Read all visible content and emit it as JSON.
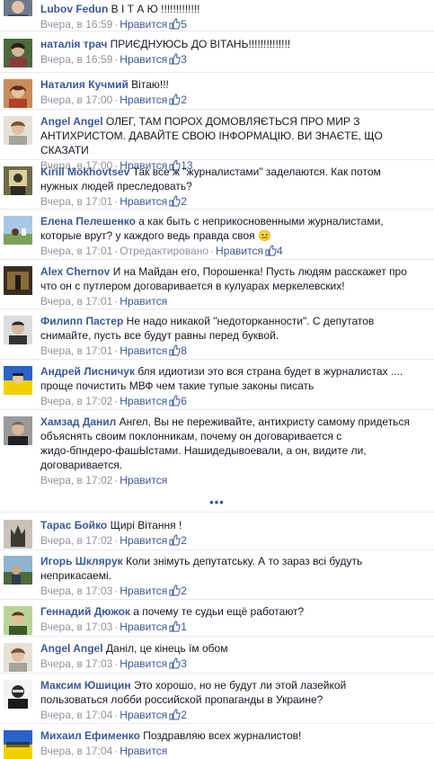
{
  "ui": {
    "like_label": "Нравится",
    "separator": "·",
    "more_label": "•••"
  },
  "comments": [
    {
      "author": "Lubov Fedun",
      "text": "В І Т А Ю !!!!!!!!!!!!!",
      "time": "Вчера, в 16:59",
      "likes": "5",
      "edited": ""
    },
    {
      "author": "наталія трач",
      "text": "ПРИЄДНУЮСЬ ДО ВІТАНЬ!!!!!!!!!!!!!!",
      "time": "Вчера, в 16:59",
      "likes": "3",
      "edited": ""
    },
    {
      "author": "Наталия Кучмий",
      "text": "Вітаю!!!",
      "time": "Вчера, в 17:00",
      "likes": "2",
      "edited": ""
    },
    {
      "author": "Angel Angel",
      "text": "ОЛЕГ, ТАМ ПОРОХ ДОМОВЛЯЄТЬСЯ ПРО МИР З\nАНТИХРИСТОМ. ДАВАЙТЕ СВОЮ ІНФОРМАЦІЮ. ВИ ЗНАЄТЕ, ЩО СКАЗАТИ",
      "time": "Вчера, в 17:00",
      "likes": "13",
      "edited": ""
    },
    {
      "author": "Kirill Mokhovtsev",
      "text": "Так все ж \"журналистами\" заделаются. Как потом\nнужных людей преследовать?",
      "time": "Вчера, в 17:01",
      "likes": "2",
      "edited": ""
    },
    {
      "author": "Елена Пелешенко",
      "text": "а как быть с неприкосновенными журналистами,\nкоторые врут? у каждого ведь правда своя 😐",
      "time": "Вчера, в 17:01",
      "likes": "4",
      "edited": "Отредактировано"
    },
    {
      "author": "Alex Chernov",
      "text": "И на Майдан его, Порошенка! Пусть людям расскажет про\nчто он с путлером договаривается в кулуарах меркелевских!",
      "time": "Вчера, в 17:01",
      "likes": "",
      "edited": ""
    },
    {
      "author": "Филипп Пастер",
      "text": "Не надо никакой \"недоторканности\". С депутатов\nснимайте, пусть все будут равны перед буквой.",
      "time": "Вчера, в 17:01",
      "likes": "8",
      "edited": ""
    },
    {
      "author": "Андрей Лисничук",
      "text": "бля идиотизи это вся страна будет в журналистах ....\nпроще почистить МВФ чем такие тупые законы писать",
      "time": "Вчера, в 17:02",
      "likes": "6",
      "edited": ""
    },
    {
      "author": "Хамзад Данил",
      "text": "Ангел, Вы не переживайте, антихристу самому придеться\nобъяснять своим поклонникам, почему он договаривается с\nжидо-бпндеро-фашЫстами. Нашидедывоевали, а он, видите ли,\nдоговаривается.",
      "time": "Вчера, в 17:02",
      "likes": "",
      "edited": ""
    },
    {
      "author": "Тарас Бойко",
      "text": "Щирі Вітання !",
      "time": "Вчера, в 17:02",
      "likes": "2",
      "edited": ""
    },
    {
      "author": "Игорь Шкляpук",
      "text": "Коли знімуть депутатську. А то зараз всі будуть\nнеприкасаемі.",
      "time": "Вчера, в 17:03",
      "likes": "2",
      "edited": ""
    },
    {
      "author": "Геннадий Дюжок",
      "text": "а почему те судьи ещё работают?",
      "time": "Вчера, в 17:03",
      "likes": "1",
      "edited": ""
    },
    {
      "author": "Angel Angel",
      "text": "Даніл, це кінець їм обом",
      "time": "Вчера, в 17:03",
      "likes": "3",
      "edited": ""
    },
    {
      "author": "Максим Юшицин",
      "text": "Это хорошо, но не будут ли этой лазейкой\nпользоваться лобби российской пропаганды в Украине?",
      "time": "Вчера, в 17:04",
      "likes": "2",
      "edited": ""
    },
    {
      "author": "Михаил Ефименко",
      "text": "Поздравляю всех журналистов!",
      "time": "Вчера, в 17:04",
      "likes": "",
      "edited": ""
    }
  ]
}
